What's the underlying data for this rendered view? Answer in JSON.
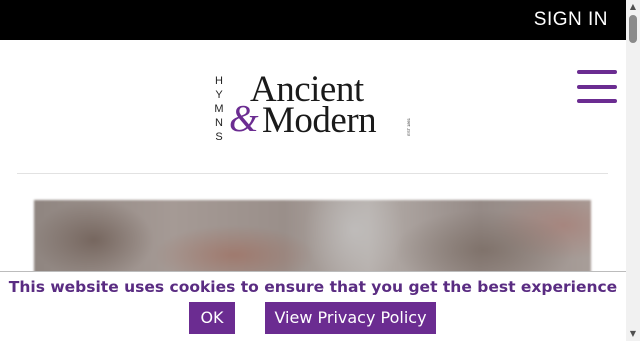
{
  "header": {
    "sign_in_label": "SIGN IN"
  },
  "logo": {
    "hymns_letters": [
      "H",
      "Y",
      "M",
      "N",
      "S"
    ],
    "ancient": "Ancient",
    "ampersand": "&",
    "modern": "Modern",
    "est": "EST 1861"
  },
  "menu": {
    "icon": "hamburger-menu-icon"
  },
  "cookie_banner": {
    "message": "This website uses cookies to ensure that you get the best experience",
    "ok_label": "OK",
    "privacy_label": "View Privacy Policy"
  },
  "colors": {
    "brand_purple": "#6b2c91",
    "topbar": "#000000"
  }
}
